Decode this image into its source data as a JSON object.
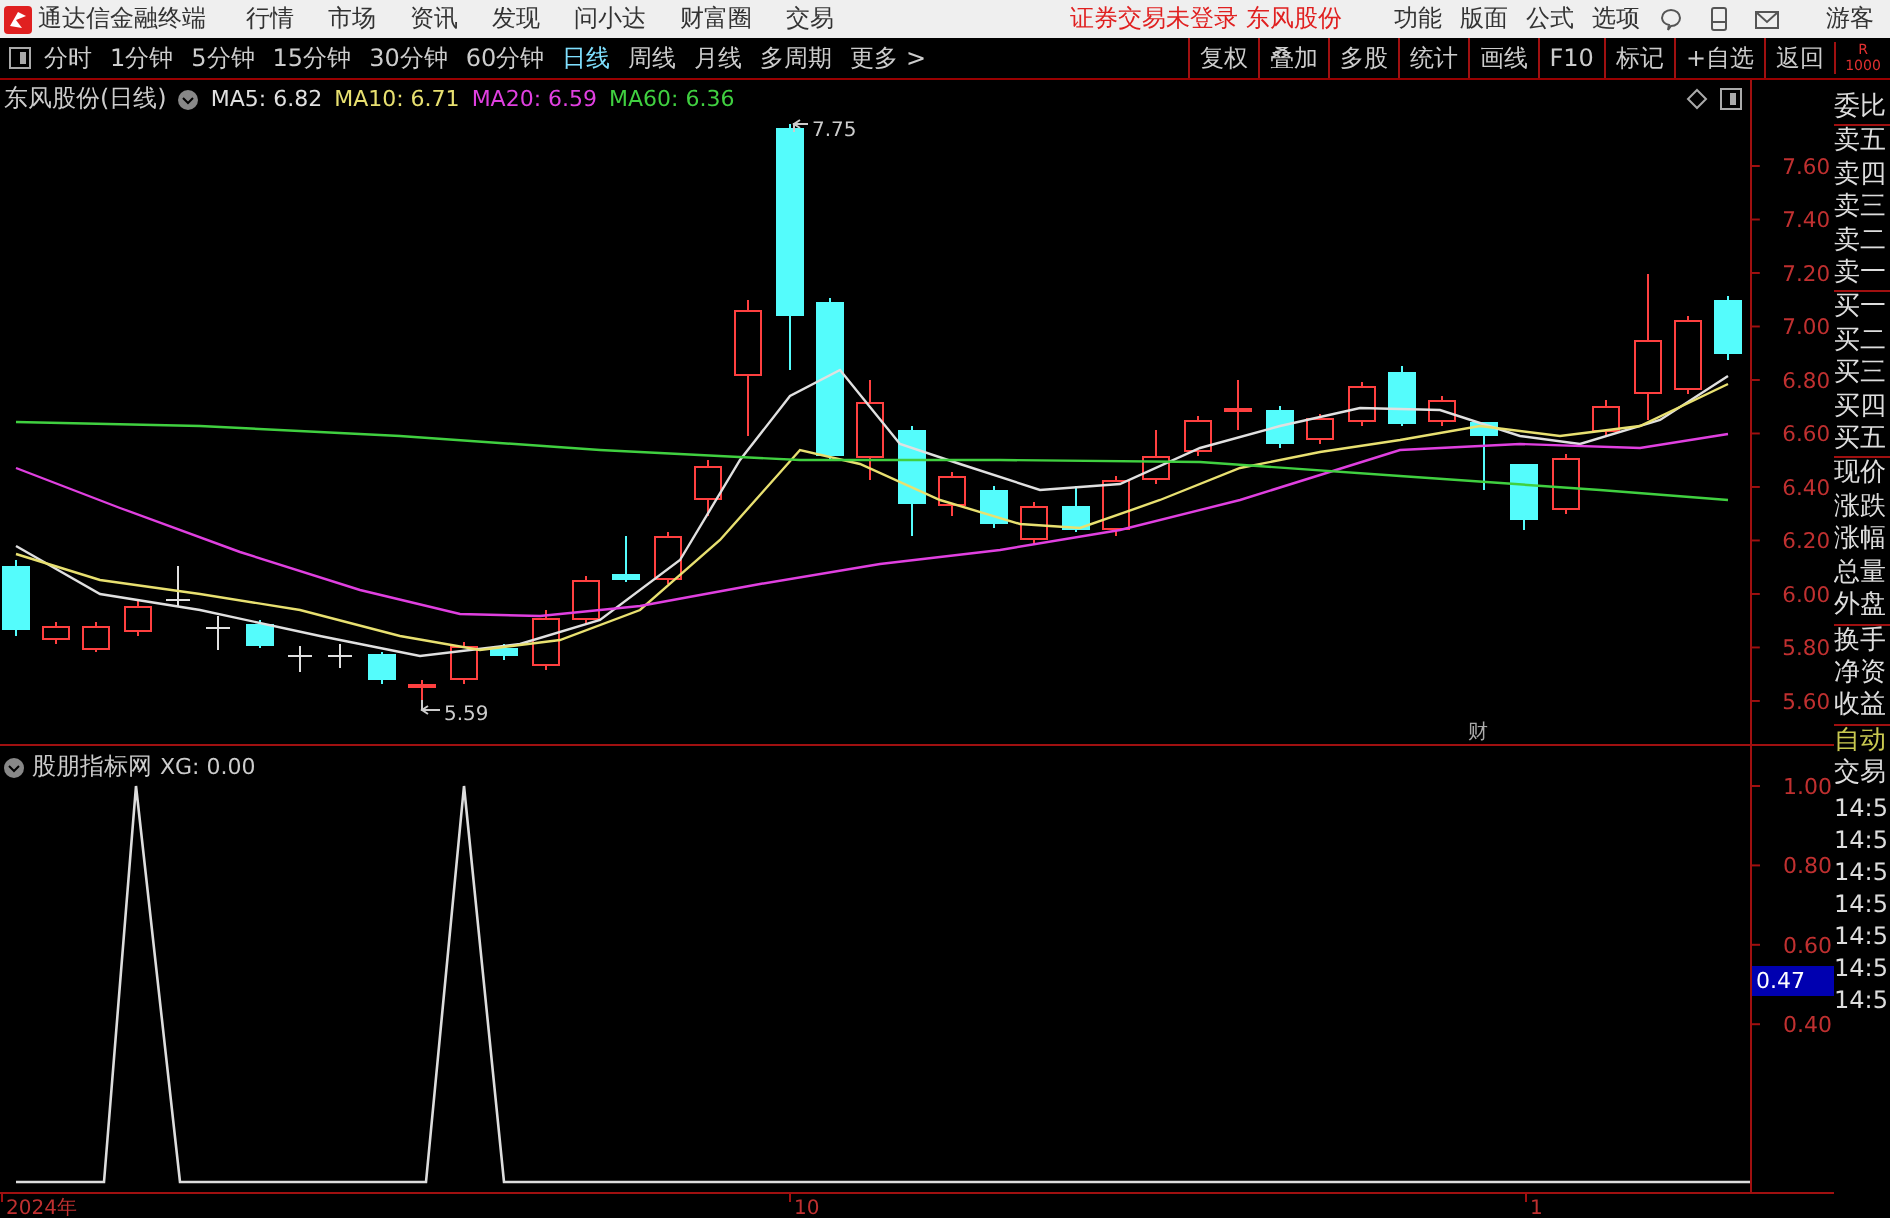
{
  "app": {
    "title": "通达信金融终端"
  },
  "menu": [
    "行情",
    "市场",
    "资讯",
    "发现",
    "问小达",
    "财富圈",
    "交易"
  ],
  "notice": {
    "status": "证券交易未登录",
    "stock": "东风股份"
  },
  "right_menu": [
    "功能",
    "版面",
    "公式",
    "选项"
  ],
  "user": "游客",
  "periods": [
    {
      "label": "分时",
      "selected": false
    },
    {
      "label": "1分钟",
      "selected": false
    },
    {
      "label": "5分钟",
      "selected": false
    },
    {
      "label": "15分钟",
      "selected": false
    },
    {
      "label": "30分钟",
      "selected": false
    },
    {
      "label": "60分钟",
      "selected": false
    },
    {
      "label": "日线",
      "selected": true
    },
    {
      "label": "周线",
      "selected": false
    },
    {
      "label": "月线",
      "selected": false
    },
    {
      "label": "多周期",
      "selected": false
    },
    {
      "label": "更多 >",
      "selected": false
    }
  ],
  "toolbar": [
    "复权",
    "叠加",
    "多股",
    "统计",
    "画线",
    "F10",
    "标记",
    "+自选",
    "返回"
  ],
  "badge": [
    "R",
    "1000"
  ],
  "main_chart": {
    "title": "东风股份(日线)",
    "indicators": [
      {
        "label": "MA5: 6.82",
        "color": "#e0e0e0"
      },
      {
        "label": "MA10: 6.71",
        "color": "#e8e070"
      },
      {
        "label": "MA20: 6.59",
        "color": "#e040e0"
      },
      {
        "label": "MA60: 6.36",
        "color": "#40d040"
      }
    ],
    "yticks": [
      "7.60",
      "7.40",
      "7.20",
      "7.00",
      "6.80",
      "6.60",
      "6.40",
      "6.20",
      "6.00",
      "5.80",
      "5.60"
    ],
    "high_label": "7.75",
    "low_label": "5.59",
    "event_marker": "财"
  },
  "sub_chart": {
    "title": "股朋指标网",
    "reading": "XG: 0.00",
    "yticks": [
      "1.00",
      "0.80",
      "0.60",
      "0.40"
    ],
    "current": "0.47"
  },
  "x_axis": [
    "2024年",
    "10",
    "1"
  ],
  "quote_panel": {
    "groups": [
      [
        "委比"
      ],
      [
        "卖五",
        "卖四",
        "卖三",
        "卖二",
        "卖一"
      ],
      [
        "买一",
        "买二",
        "买三",
        "买四",
        "买五"
      ],
      [
        "现价",
        "涨跌",
        "涨幅",
        "总量",
        "外盘"
      ],
      [
        "换手",
        "净资",
        "收益"
      ]
    ],
    "mode": "自动",
    "trades_title": "交易",
    "times": [
      "14:5",
      "14:5",
      "14:5",
      "14:5",
      "14:5",
      "14:5",
      "14:5"
    ]
  }
}
